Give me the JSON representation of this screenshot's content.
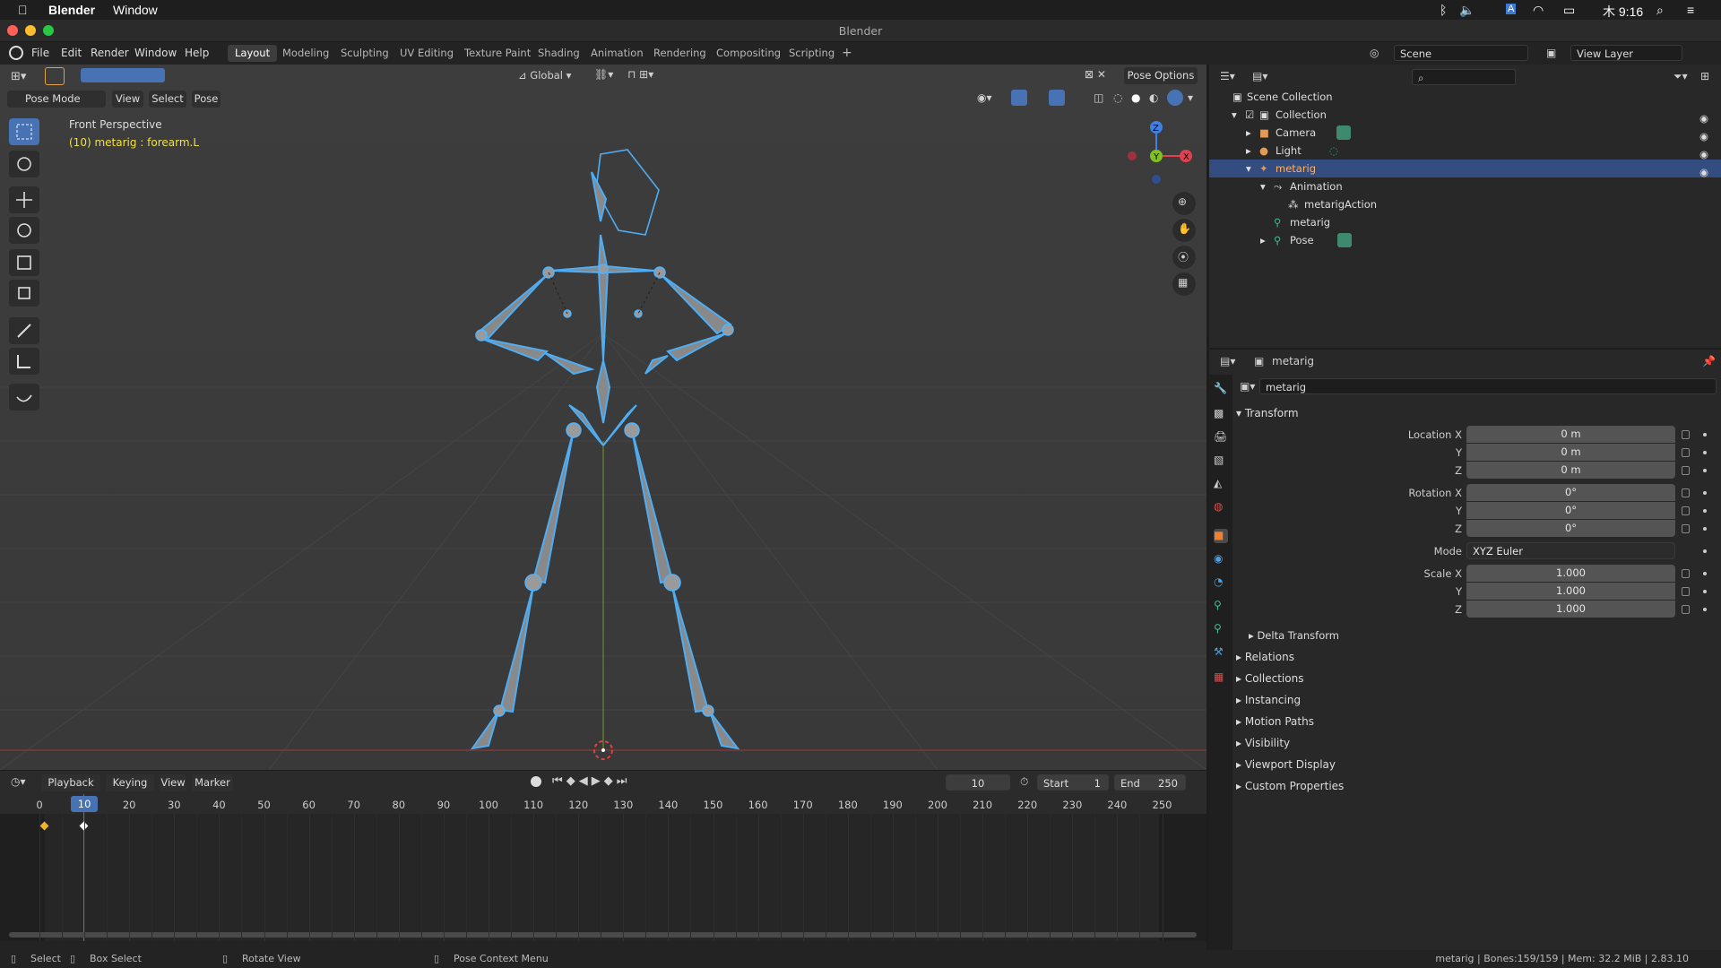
{
  "mac": {
    "app": "Blender",
    "menu_window": "Window",
    "clock": "木 9:16"
  },
  "window": {
    "title": "Blender"
  },
  "menus": [
    "File",
    "Edit",
    "Render",
    "Window",
    "Help"
  ],
  "workspaces": [
    "Layout",
    "Modeling",
    "Sculpting",
    "UV Editing",
    "Texture Paint",
    "Shading",
    "Animation",
    "Rendering",
    "Compositing",
    "Scripting",
    "+"
  ],
  "scene": {
    "name": "Scene",
    "view_layer": "View Layer"
  },
  "viewport": {
    "orientation": "Global",
    "pose_options": "Pose Options",
    "mode": "Pose Mode",
    "header_menus": [
      "View",
      "Select",
      "Pose"
    ],
    "overlay_title": "Front Perspective",
    "overlay_sub": "(10) metarig : forearm.L",
    "gizmo": {
      "x": "X",
      "y": "Y",
      "z": "Z"
    }
  },
  "timeline": {
    "menus": [
      "Playback",
      "Keying",
      "View",
      "Marker"
    ],
    "current_frame": "10",
    "start_label": "Start",
    "start": "1",
    "end_label": "End",
    "end": "250",
    "ticks": [
      "0",
      "10",
      "20",
      "30",
      "40",
      "50",
      "60",
      "70",
      "80",
      "90",
      "100",
      "110",
      "120",
      "130",
      "140",
      "150",
      "160",
      "170",
      "180",
      "190",
      "200",
      "210",
      "220",
      "230",
      "240",
      "250"
    ]
  },
  "outliner": {
    "scene_collection": "Scene Collection",
    "rows": [
      "Collection",
      "Camera",
      "Light",
      "metarig",
      "Animation",
      "metarigAction",
      "metarig",
      "Pose"
    ]
  },
  "properties": {
    "object_name": "metarig",
    "datablock": "metarig",
    "transform_header": "Transform",
    "location": {
      "label": "Location X",
      "x": "0 m",
      "y": "0 m",
      "z": "0 m"
    },
    "rotation": {
      "label": "Rotation X",
      "x": "0°",
      "y": "0°",
      "z": "0°"
    },
    "mode_label": "Mode",
    "mode": "XYZ Euler",
    "scale": {
      "label": "Scale X",
      "x": "1.000",
      "y": "1.000",
      "z": "1.000"
    },
    "axis_y": "Y",
    "axis_z": "Z",
    "delta": "Delta Transform",
    "panels": [
      "Relations",
      "Collections",
      "Instancing",
      "Motion Paths",
      "Visibility",
      "Viewport Display",
      "Custom Properties"
    ]
  },
  "status": {
    "select": "Select",
    "box_select": "Box Select",
    "rotate_view": "Rotate View",
    "context_menu": "Pose Context Menu",
    "stats": "metarig | Bones:159/159 | Mem: 32.2 MiB | 2.83.10"
  }
}
